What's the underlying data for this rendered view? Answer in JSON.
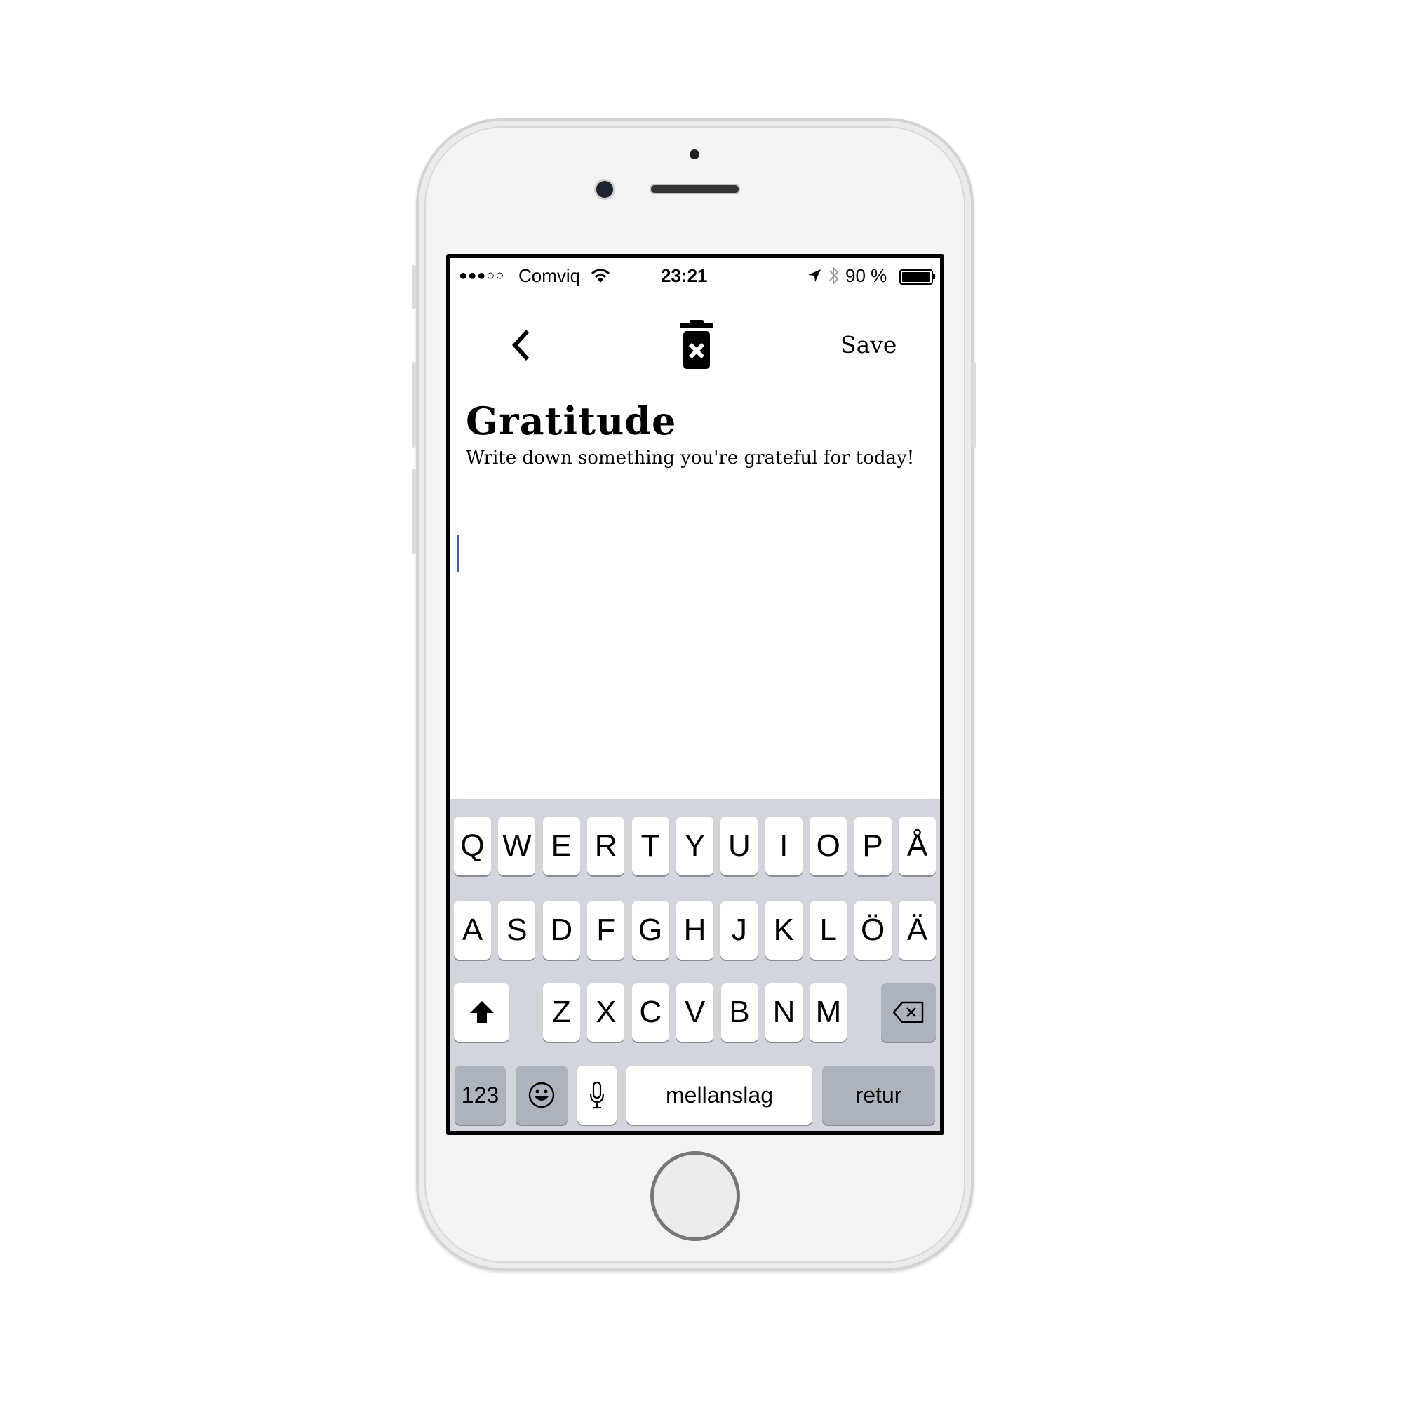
{
  "status_bar": {
    "signal": "●●●○○",
    "carrier": "Comviq",
    "time": "23:21",
    "battery": "90 %",
    "battery_level": 0.9
  },
  "nav": {
    "save_label": "Save"
  },
  "content": {
    "title": "Gratitude",
    "prompt": "Write down something you're grateful for today!",
    "entry_text": ""
  },
  "keyboard": {
    "row1": [
      "Q",
      "W",
      "E",
      "R",
      "T",
      "Y",
      "U",
      "I",
      "O",
      "P",
      "Å"
    ],
    "row2": [
      "A",
      "S",
      "D",
      "F",
      "G",
      "H",
      "J",
      "K",
      "L",
      "Ö",
      "Ä"
    ],
    "row3": [
      "Z",
      "X",
      "C",
      "V",
      "B",
      "N",
      "M"
    ],
    "numbers_label": "123",
    "space_label": "mellanslag",
    "return_label": "retur"
  },
  "colors": {
    "cursor": "#3b5ce0",
    "keyboard_bg": "#d2d5db",
    "key_dark": "#adb3bc"
  }
}
